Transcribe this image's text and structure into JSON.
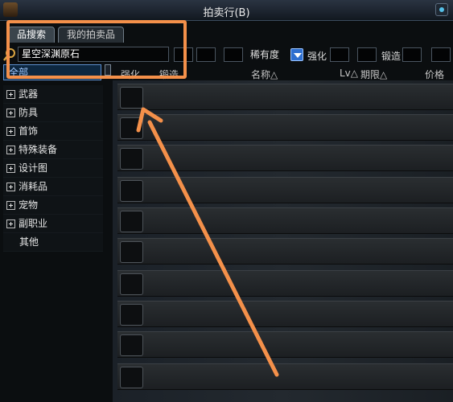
{
  "window": {
    "title": "拍卖行(B)"
  },
  "tabs": [
    {
      "label": "品搜索"
    },
    {
      "label": "我的拍卖品"
    }
  ],
  "search": {
    "value": "星空深渊原石"
  },
  "filters": {
    "rarity_label": "稀有度",
    "enhance_label": "强化",
    "forge_label": "锻造"
  },
  "categories": {
    "all": "全部",
    "items": [
      {
        "label": "武器"
      },
      {
        "label": "防具"
      },
      {
        "label": "首饰"
      },
      {
        "label": "特殊装备"
      },
      {
        "label": "设计图"
      },
      {
        "label": "消耗品"
      },
      {
        "label": "宠物"
      },
      {
        "label": "副职业"
      },
      {
        "label": "其他"
      }
    ]
  },
  "columns": {
    "enhance": "强化",
    "forge": "锻造",
    "name": "名称△",
    "level": "Lv△",
    "period": "期限△",
    "price": "价格(金"
  },
  "annotation_colors": {
    "highlight": "#f4904a"
  }
}
